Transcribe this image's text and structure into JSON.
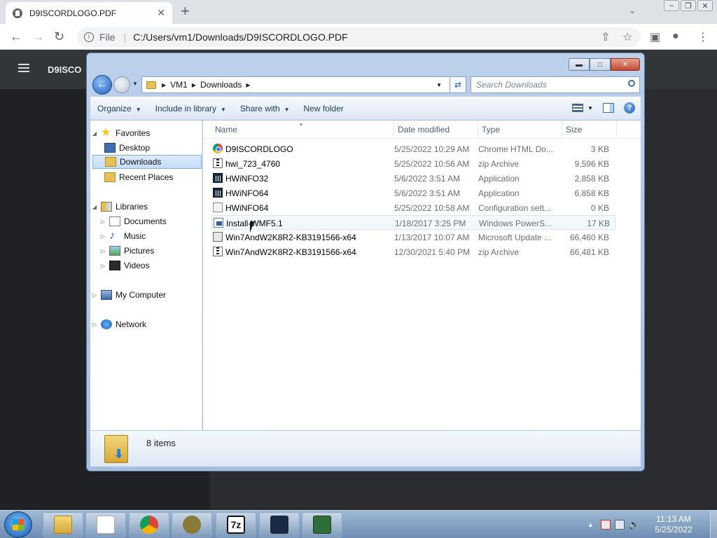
{
  "browser": {
    "tab_title": "D9ISCORDLOGO.PDF",
    "tab_close": "✕",
    "new_tab": "+",
    "url_scheme_label": "File",
    "url": "C:/Users/vm1/Downloads/D9ISCORDLOGO.PDF"
  },
  "pdf_viewer": {
    "title": "D9ISCO"
  },
  "explorer": {
    "breadcrumbs": [
      "VM1",
      "Downloads"
    ],
    "search_placeholder": "Search Downloads",
    "toolbar": {
      "organize": "Organize",
      "include_in_library": "Include in library",
      "share_with": "Share with",
      "new_folder": "New folder"
    },
    "nav": {
      "favorites": "Favorites",
      "desktop": "Desktop",
      "downloads": "Downloads",
      "recent_places": "Recent Places",
      "libraries": "Libraries",
      "documents": "Documents",
      "music": "Music",
      "pictures": "Pictures",
      "videos": "Videos",
      "my_computer": "My Computer",
      "network": "Network"
    },
    "columns": {
      "name": "Name",
      "date_modified": "Date modified",
      "type": "Type",
      "size": "Size"
    },
    "files": [
      {
        "name": "D9ISCORDLOGO",
        "date": "5/25/2022 10:29 AM",
        "type": "Chrome HTML Do...",
        "size": "3 KB",
        "icon": "chrome-icon"
      },
      {
        "name": "hwi_723_4760",
        "date": "5/25/2022 10:56 AM",
        "type": "zip Archive",
        "size": "9,596 KB",
        "icon": "zip-icon"
      },
      {
        "name": "HWiNFO32",
        "date": "5/6/2022 3:51 AM",
        "type": "Application",
        "size": "2,858 KB",
        "icon": "app-icon"
      },
      {
        "name": "HWiNFO64",
        "date": "5/6/2022 3:51 AM",
        "type": "Application",
        "size": "6,858 KB",
        "icon": "app-icon"
      },
      {
        "name": "HWiNFO64",
        "date": "5/25/2022 10:58 AM",
        "type": "Configuration sett...",
        "size": "0 KB",
        "icon": "config-icon"
      },
      {
        "name": "Install-WMF5.1",
        "date": "1/18/2017 3:25 PM",
        "type": "Windows PowerS...",
        "size": "17 KB",
        "icon": "powershell-icon"
      },
      {
        "name": "Win7AndW2K8R2-KB3191566-x64",
        "date": "1/13/2017 10:07 AM",
        "type": "Microsoft Update ...",
        "size": "66,460 KB",
        "icon": "msu-icon"
      },
      {
        "name": "Win7AndW2K8R2-KB3191566-x64",
        "date": "12/30/2021 5:40 PM",
        "type": "zip Archive",
        "size": "66,481 KB",
        "icon": "zip-icon"
      }
    ],
    "item_count": "8 items"
  },
  "taskbar": {
    "time": "11:13 AM",
    "date": "5/25/2022",
    "seven_zip_label": "7z"
  }
}
